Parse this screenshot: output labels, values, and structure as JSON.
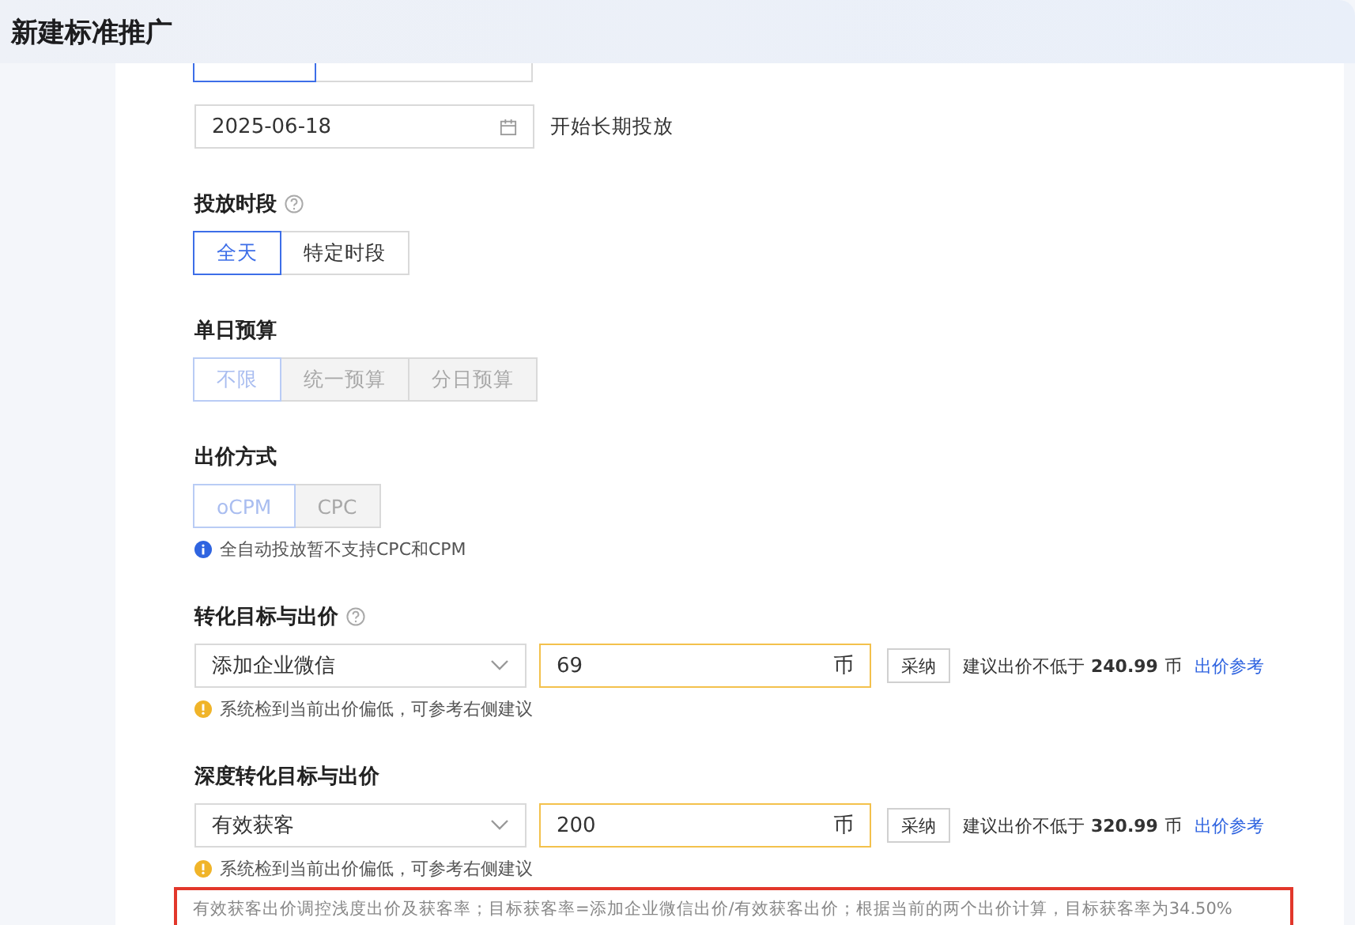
{
  "window": {
    "title": "新建标准推广"
  },
  "top_segment": {
    "options": [
      {
        "selected": true
      },
      {
        "selected": false
      }
    ]
  },
  "date_field": {
    "value": "2025-06-18",
    "suffix": "开始长期投放"
  },
  "sections": [
    {
      "kind": "segments",
      "label": "投放时段",
      "help": true,
      "options": [
        {
          "label": "全天",
          "selected": true,
          "disabled": false
        },
        {
          "label": "特定时段",
          "selected": false,
          "disabled": false
        }
      ]
    },
    {
      "kind": "segments",
      "label": "单日预算",
      "help": false,
      "options": [
        {
          "label": "不限",
          "selected": true,
          "disabled": true
        },
        {
          "label": "统一预算",
          "selected": false,
          "disabled": true
        },
        {
          "label": "分日预算",
          "selected": false,
          "disabled": true
        }
      ]
    },
    {
      "kind": "segments",
      "label": "出价方式",
      "help": false,
      "options": [
        {
          "label": "oCPM",
          "selected": true,
          "disabled": true
        },
        {
          "label": "CPC",
          "selected": false,
          "disabled": true
        }
      ],
      "note": {
        "kind": "info",
        "text": "全自动投放暂不支持CPC和CPM"
      }
    },
    {
      "kind": "bid",
      "label": "转化目标与出价",
      "help": true,
      "select": "添加企业微信",
      "bid": "69",
      "unit": "币",
      "adopt": "采纳",
      "suggest_prefix": "建议出价不低于",
      "suggest_value": "240.99",
      "suggest_unit": "币",
      "link": "出价参考",
      "note": {
        "kind": "warning",
        "text": "系统检到当前出价偏低，可参考右侧建议"
      }
    },
    {
      "kind": "bid",
      "label": "深度转化目标与出价",
      "help": false,
      "select": "有效获客",
      "bid": "200",
      "unit": "币",
      "adopt": "采纳",
      "suggest_prefix": "建议出价不低于",
      "suggest_value": "320.99",
      "suggest_unit": "币",
      "link": "出价参考",
      "note": {
        "kind": "warning",
        "text": "系统检到当前出价偏低，可参考右侧建议"
      }
    }
  ],
  "highlight_note": "有效获客出价调控浅度出价及获客率；目标获客率=添加企业微信出价/有效获客出价；根据当前的两个出价计算，目标获客率为34.50%"
}
